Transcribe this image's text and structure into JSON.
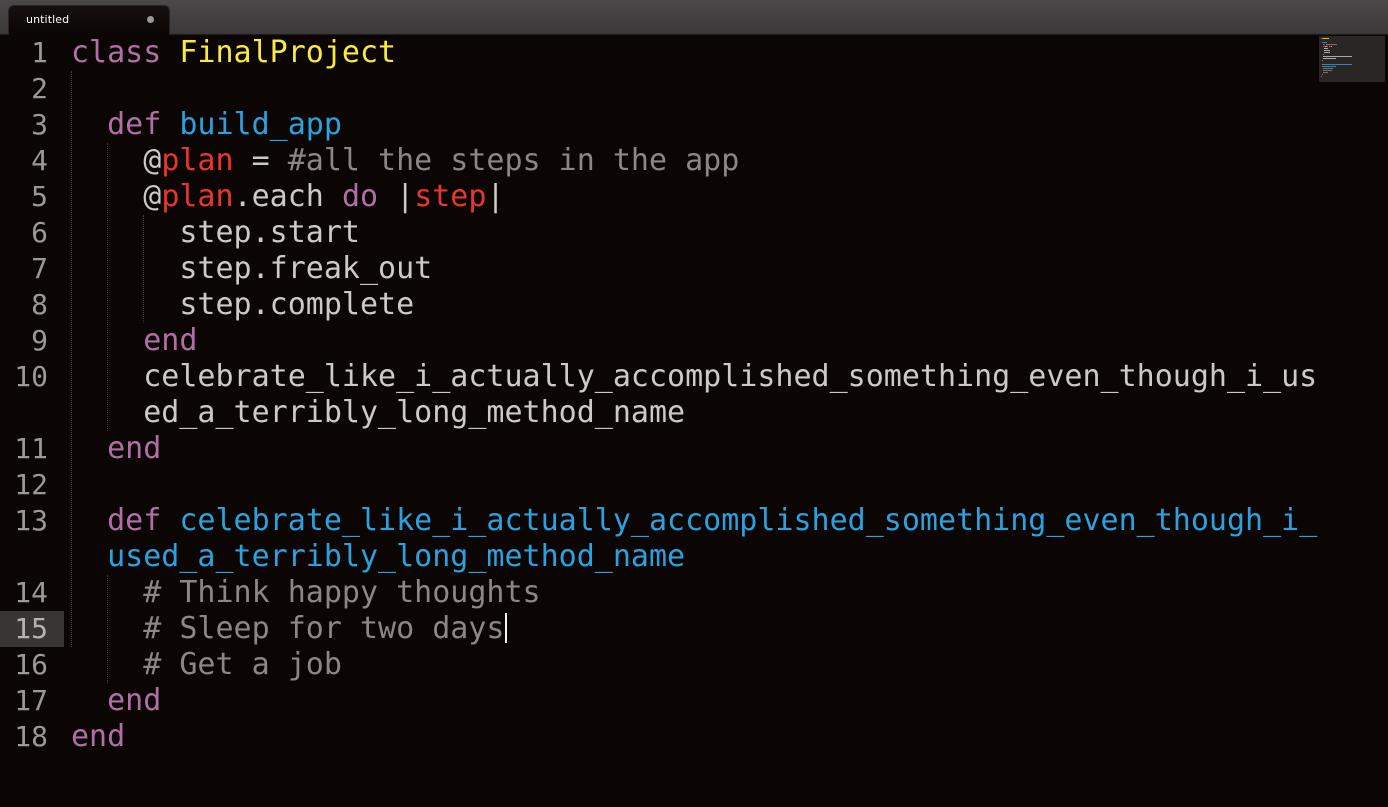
{
  "tab": {
    "title": "untitled"
  },
  "colors": {
    "background": "#0b0504",
    "keyword": "#b06fa8",
    "class_name": "#f7ec3d",
    "function_name": "#2aa2e0",
    "variable": "#e8362c",
    "default_text": "#cccac8",
    "comment": "#8d8682"
  },
  "editor": {
    "current_line": 15,
    "lines": [
      {
        "number": "1",
        "tokens": [
          {
            "text": "class ",
            "color": "#b06fa8"
          },
          {
            "text": "FinalProject",
            "color": "#f7ec3d"
          }
        ]
      },
      {
        "number": "2",
        "tokens": []
      },
      {
        "number": "3",
        "tokens": [
          {
            "text": "  def ",
            "color": "#b06fa8"
          },
          {
            "text": "build_app",
            "color": "#2aa2e0"
          }
        ]
      },
      {
        "number": "4",
        "tokens": [
          {
            "text": "    @",
            "color": "#cccac8"
          },
          {
            "text": "plan",
            "color": "#e8362c"
          },
          {
            "text": " = ",
            "color": "#cccac8"
          },
          {
            "text": "#all the steps in the app",
            "color": "#8d8682"
          }
        ]
      },
      {
        "number": "5",
        "tokens": [
          {
            "text": "    @",
            "color": "#cccac8"
          },
          {
            "text": "plan",
            "color": "#e8362c"
          },
          {
            "text": ".each ",
            "color": "#cccac8"
          },
          {
            "text": "do",
            "color": "#b06fa8"
          },
          {
            "text": " |",
            "color": "#cccac8"
          },
          {
            "text": "step",
            "color": "#e8362c"
          },
          {
            "text": "|",
            "color": "#cccac8"
          }
        ]
      },
      {
        "number": "6",
        "tokens": [
          {
            "text": "      step.start",
            "color": "#cccac8"
          }
        ]
      },
      {
        "number": "7",
        "tokens": [
          {
            "text": "      step.freak_out",
            "color": "#cccac8"
          }
        ]
      },
      {
        "number": "8",
        "tokens": [
          {
            "text": "      step.complete",
            "color": "#cccac8"
          }
        ]
      },
      {
        "number": "9",
        "tokens": [
          {
            "text": "    end",
            "color": "#b06fa8"
          }
        ]
      },
      {
        "number": "10",
        "tokens": [
          {
            "text": "    celebrate_like_i_actually_accomplished_something_even_though_i_us",
            "color": "#cccac8"
          }
        ]
      },
      {
        "number": "",
        "tokens": [
          {
            "text": "    ed_a_terribly_long_method_name",
            "color": "#cccac8"
          }
        ]
      },
      {
        "number": "11",
        "tokens": [
          {
            "text": "  end",
            "color": "#b06fa8"
          }
        ]
      },
      {
        "number": "12",
        "tokens": []
      },
      {
        "number": "13",
        "tokens": [
          {
            "text": "  def ",
            "color": "#b06fa8"
          },
          {
            "text": "celebrate_like_i_actually_accomplished_something_even_though_i_",
            "color": "#2aa2e0"
          }
        ]
      },
      {
        "number": "",
        "tokens": [
          {
            "text": "  used_a_terribly_long_method_name",
            "color": "#2aa2e0"
          }
        ]
      },
      {
        "number": "14",
        "tokens": [
          {
            "text": "    # Think happy thoughts",
            "color": "#8d8682"
          }
        ]
      },
      {
        "number": "15",
        "tokens": [
          {
            "text": "    # Sleep for two days",
            "color": "#8d8682"
          }
        ],
        "cursor": true
      },
      {
        "number": "16",
        "tokens": [
          {
            "text": "    # Get a job",
            "color": "#8d8682"
          }
        ]
      },
      {
        "number": "17",
        "tokens": [
          {
            "text": "  end",
            "color": "#b06fa8"
          }
        ]
      },
      {
        "number": "18",
        "tokens": [
          {
            "text": "end",
            "color": "#b06fa8"
          }
        ]
      }
    ]
  }
}
